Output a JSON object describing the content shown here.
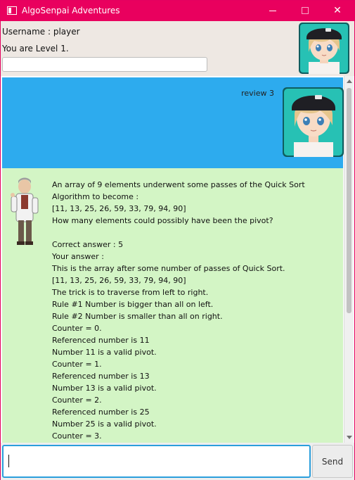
{
  "window": {
    "title": "AlgoSenpai Adventures",
    "icon": "app-window-icon",
    "controls": {
      "minimize": "minimize-icon",
      "maximize": "maximize-icon",
      "close": "✕"
    }
  },
  "header": {
    "username": "Username : player",
    "level": "You are Level 1.",
    "progress": 0,
    "avatar": "player-avatar"
  },
  "chat": {
    "user_message": {
      "text": "review 3",
      "avatar": "player-avatar"
    },
    "bot_message": {
      "avatar": "professor-avatar",
      "lines": [
        "An array of 9 elements underwent some passes of the Quick Sort Algorithm to become :",
        "[11, 13, 25, 26, 59, 33, 79, 94, 90]",
        "How many elements could possibly have been the pivot?",
        "",
        "Correct answer : 5",
        "Your answer :",
        "This is the array after some number of passes of Quick Sort.",
        "[11, 13, 25, 26, 59, 33, 79, 94, 90]",
        "The trick is to traverse from left to right.",
        "Rule #1 Number is bigger than all on left.",
        "Rule #2 Number is smaller than all on right.",
        "Counter = 0.",
        "Referenced number is 11",
        "Number 11 is a valid pivot.",
        "Counter = 1.",
        "Referenced number is 13",
        "Number 13 is a valid pivot.",
        "Counter = 2.",
        "Referenced number is 25",
        "Number 25 is a valid pivot.",
        "Counter = 3."
      ]
    }
  },
  "input": {
    "value": "",
    "send_label": "Send"
  },
  "colors": {
    "titlebar": "#e9005e",
    "user_bubble": "#2dabee",
    "bot_bubble": "#d3f5c5",
    "input_focus": "#2b9fdc"
  }
}
